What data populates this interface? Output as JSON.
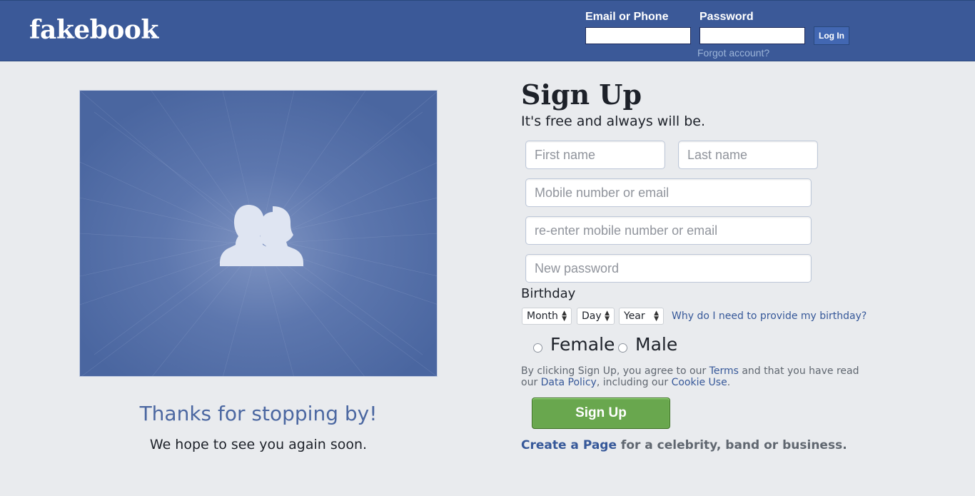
{
  "header": {
    "logo": "fakebook",
    "email_label": "Email or Phone",
    "password_label": "Password",
    "email_value": "",
    "password_value": "",
    "login_label": "Log In",
    "forgot_label": "Forgot account?"
  },
  "hero": {
    "caption": "Thanks for stopping by!",
    "subcaption": "We hope to see you again soon."
  },
  "signup": {
    "title": "Sign Up",
    "subtitle": "It's free and always will be.",
    "first_name_placeholder": "First name",
    "last_name_placeholder": "Last name",
    "contact_placeholder": "Mobile number or email",
    "contact_confirm_placeholder": "re-enter mobile number or email",
    "password_placeholder": "New password",
    "birthday_label": "Birthday",
    "month_label": "Month",
    "day_label": "Day",
    "year_label": "Year",
    "why_birthday": "Why do I need to provide my birthday?",
    "female_label": "Female",
    "male_label": "Male",
    "terms_prefix": "By clicking Sign Up, you agree to our ",
    "terms_link": "Terms",
    "terms_middle": " and that you have read our ",
    "data_policy_link": "Data Policy",
    "terms_middle2": ", including our ",
    "cookie_link": "Cookie Use",
    "terms_suffix": ".",
    "button_label": "Sign Up",
    "create_page_link": "Create a Page",
    "create_page_suffix": " for a celebrity, band or business."
  },
  "colors": {
    "brand_blue": "#3b5998",
    "background": "#e9ebee",
    "signup_green": "#69a74e",
    "link_blue": "#365899"
  },
  "icons": {
    "hero_illustration": "two-people-silhouette-icon"
  }
}
